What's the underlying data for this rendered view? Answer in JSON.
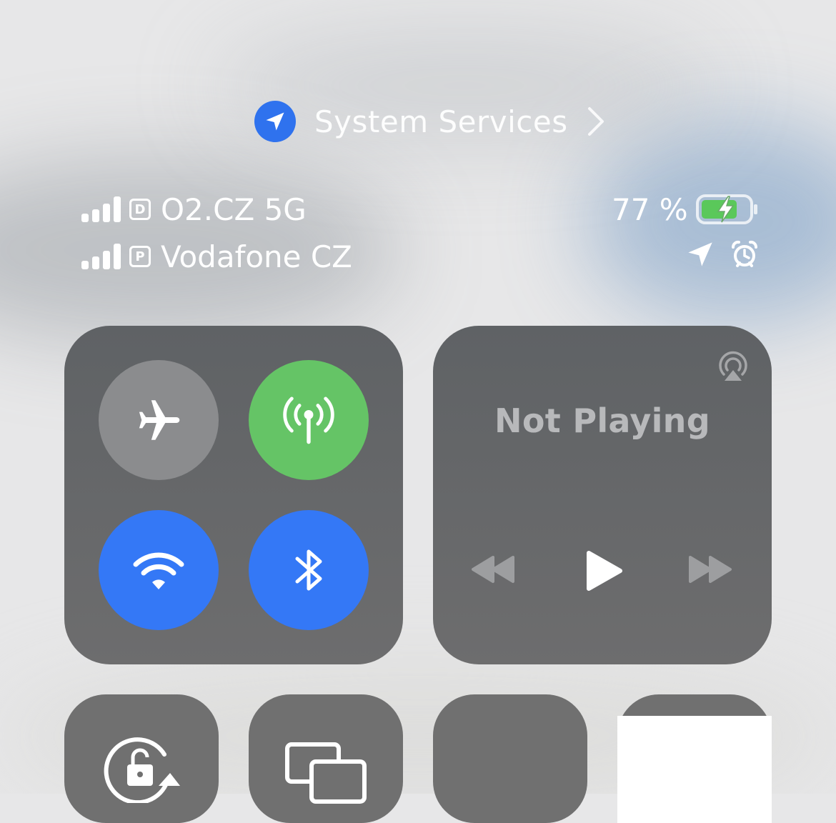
{
  "location_services": {
    "label": "System Services",
    "icon": "location-arrow-icon",
    "accent": "#2f72ee"
  },
  "status_bar": {
    "carriers": [
      {
        "sim_label": "D",
        "name": "O2.CZ 5G"
      },
      {
        "sim_label": "P",
        "name": "Vodafone CZ"
      }
    ],
    "battery": {
      "percent_label": "77 %",
      "level": 0.77,
      "charging": true,
      "fill_color": "#5ac85a"
    },
    "indicators": [
      "location-arrow-icon",
      "alarm-icon"
    ]
  },
  "connectivity": {
    "airplane": {
      "icon": "airplane-icon",
      "on": false,
      "color": "#8b8c8e"
    },
    "cellular_data": {
      "icon": "cellular-antenna-icon",
      "on": true,
      "color": "#65c466"
    },
    "wifi": {
      "icon": "wifi-icon",
      "on": true,
      "color": "#3478f6"
    },
    "bluetooth": {
      "icon": "bluetooth-icon",
      "on": true,
      "color": "#3478f6"
    }
  },
  "now_playing": {
    "title": "Not Playing",
    "controls": [
      "rewind-icon",
      "play-icon",
      "fast-forward-icon"
    ],
    "airplay_icon": "airplay-audio-icon"
  },
  "bottom_tiles": [
    "orientation-lock-icon",
    "screen-mirroring-icon",
    "tile-3",
    "tile-4"
  ]
}
